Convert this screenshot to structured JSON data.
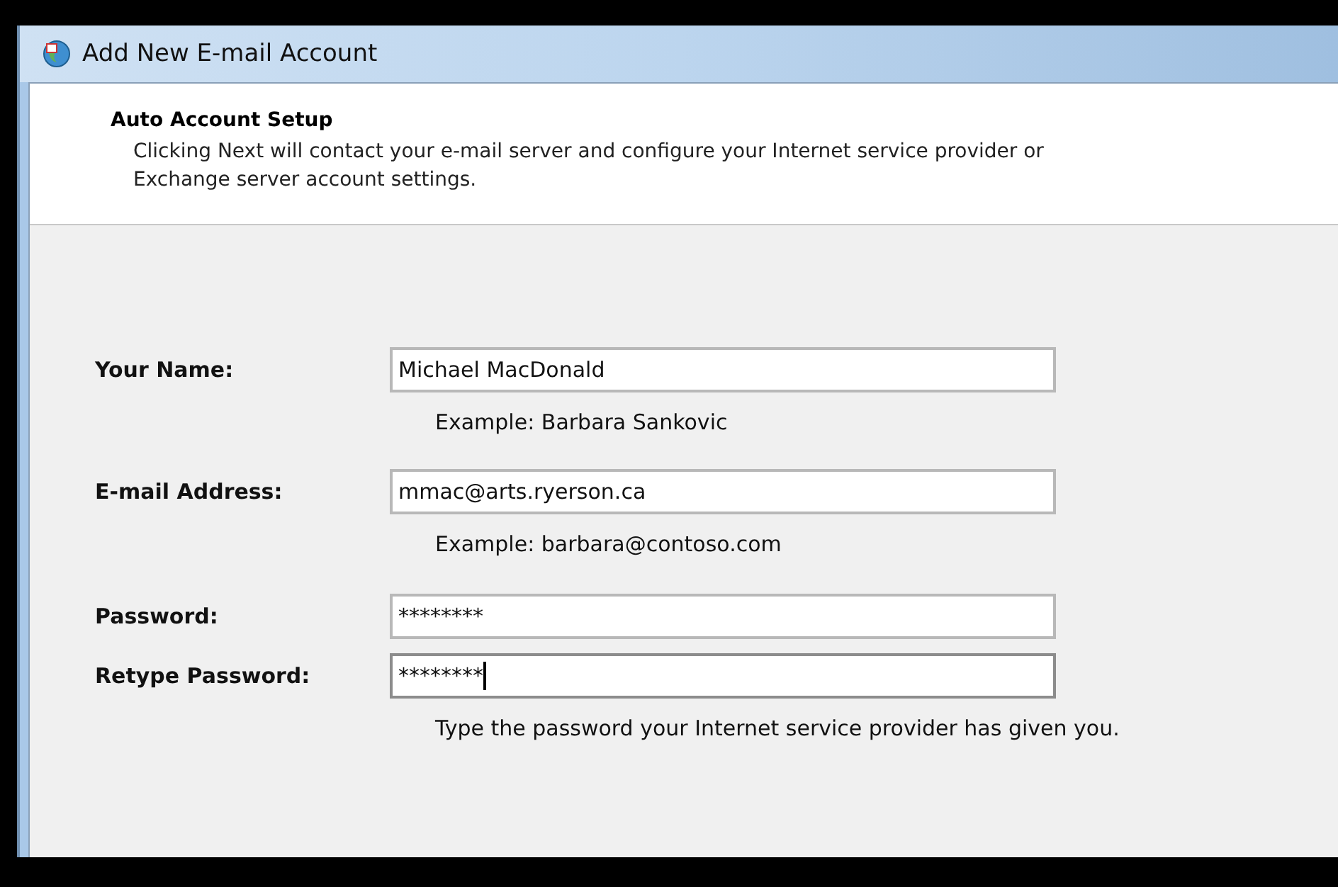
{
  "window": {
    "title": "Add New E-mail Account"
  },
  "header": {
    "title": "Auto Account Setup",
    "description": "Clicking Next will contact your e-mail server and configure your Internet service provider or Exchange server account settings."
  },
  "fields": [
    {
      "label": "Your Name:",
      "value": "Michael MacDonald",
      "focused": false,
      "hint": "Example: Barbara Sankovic"
    },
    {
      "label": "E-mail Address:",
      "value": "mmac@arts.ryerson.ca",
      "focused": false,
      "hint": "Example: barbara@contoso.com"
    },
    {
      "label": "Password:",
      "value": "********",
      "focused": false
    },
    {
      "label": "Retype Password:",
      "value": "********",
      "focused": true,
      "hint": "Type the password your Internet service provider has given you."
    }
  ]
}
